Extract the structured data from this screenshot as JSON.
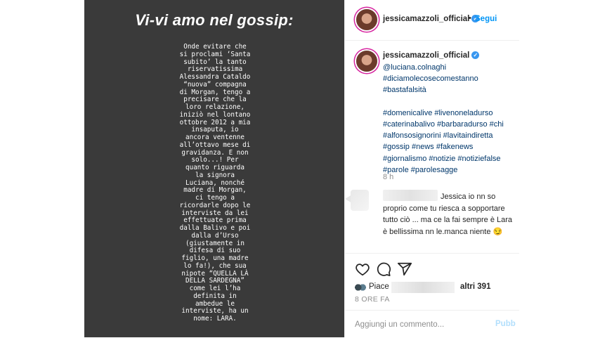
{
  "story": {
    "title": "Vi-vi amo nel gossip:",
    "body": "Onde evitare che\nsi proclami ‘Santa\nsubito’ la tanto\nriservatissima\nAlessandra Cataldo\n“nuova” compagna\ndi Morgan, tengo a\nprecisare che la\nloro relazione,\niniziò nel lontano\nottobre 2012 a mia\ninsaputa, io\nancora ventenne\nall’ottavo mese di\ngravidanza. E non\nsolo...! Per\nquanto riguarda\nla signora\nLuciana, nonché\nmadre di Morgan,\nci tengo a\nricordarle dopo le\ninterviste da lei\neffettuate prima\ndalla Balivo e poi\ndalla d’Urso\n(giustamente in\ndifesa di suo\nfiglio, una madre\nlo fa!), che sua\nnipote “QUELLA LÀ\nDELLA SARDEGNA”\ncome lei l’ha\ndefinita in\nambedue le\ninterviste, ha un\nnome: LARA."
  },
  "header": {
    "username": "jessicamazzoli_official",
    "separator": "•",
    "follow_label": "Segui"
  },
  "caption": {
    "username": "jessicamazzoli_official",
    "tags_group1": [
      "@luciana.colnaghi",
      "#diciamolecosecomestanno",
      "#bastafalsità"
    ],
    "tags_group2": [
      "#domenicalive #livenoneladurso",
      "#caterinabalivo #barbaradurso #chi",
      "#alfonsosignorini #lavitaindiretta",
      "#gossip #news #fakenews",
      "#giornalismo #notizie #notiziefalse",
      "#parole #parolesagge"
    ],
    "time": "8 h"
  },
  "comment": {
    "text": "Jessica io nn so proprio come tu riesca a sopportare tutto ciò ... ma ce la fai sempre è Lara è bellissima nn le.manca niente 😏"
  },
  "actions": {
    "likes_prefix": "Piace",
    "likes_count": "altri 391",
    "post_time": "8 ORE FA"
  },
  "add_comment": {
    "placeholder": "Aggiungi un commento...",
    "publish_label": "Pubb"
  },
  "colors": {
    "accent": "#0095f6",
    "hashtag": "#00376b",
    "story_bg": "#3a3a3a",
    "muted": "#8e8e8e"
  }
}
